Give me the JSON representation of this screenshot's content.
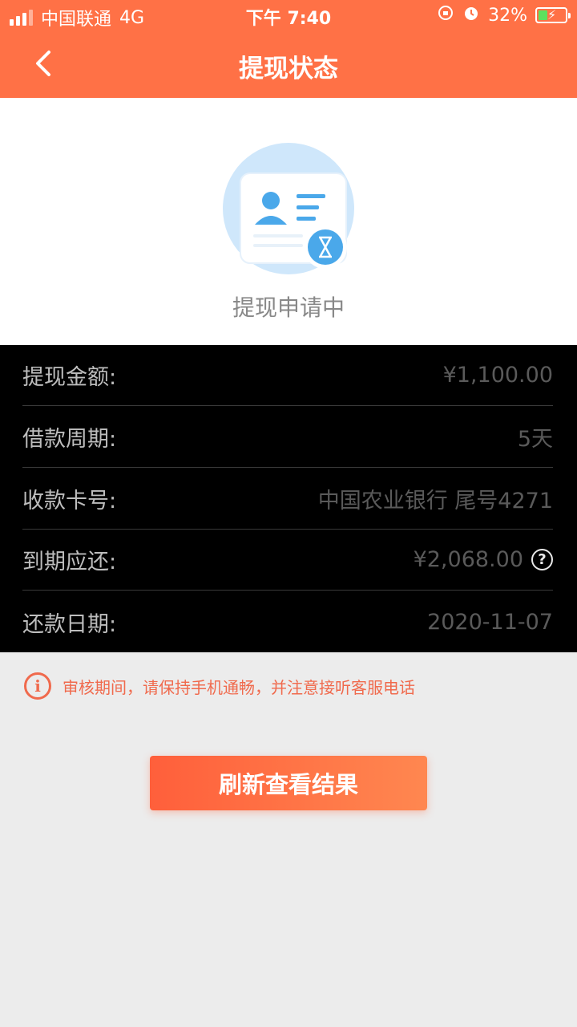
{
  "status_bar": {
    "carrier": "中国联通",
    "network": "4G",
    "time": "下午 7:40",
    "battery": "32%"
  },
  "nav": {
    "title": "提现状态"
  },
  "hero": {
    "status_text": "提现申请中"
  },
  "details": [
    {
      "label": "提现金额:",
      "value": "¥1,100.00"
    },
    {
      "label": "借款周期:",
      "value": "5天"
    },
    {
      "label": "收款卡号:",
      "value": "中国农业银行 尾号4271"
    },
    {
      "label": "到期应还:",
      "value": "¥2,068.00"
    },
    {
      "label": "还款日期:",
      "value": "2020-11-07"
    }
  ],
  "notice": {
    "text": "审核期间，请保持手机通畅，并注意接听客服电话"
  },
  "refresh_button": {
    "label": "刷新查看结果"
  },
  "colors": {
    "accent": "#ff7146",
    "notice": "#f06a4d",
    "hero_icon_blue": "#4aa8ea"
  }
}
